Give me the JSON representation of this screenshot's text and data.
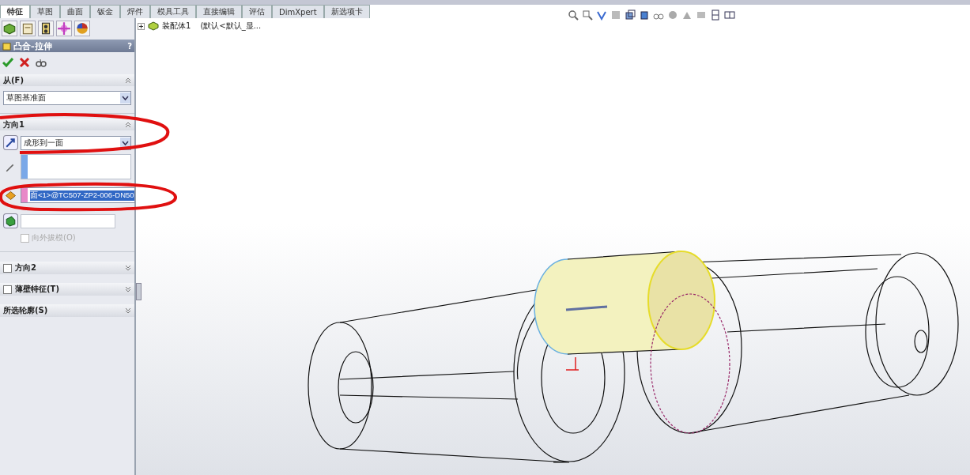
{
  "tabs": [
    {
      "label": "特征",
      "selected": true
    },
    {
      "label": "草图",
      "selected": false
    },
    {
      "label": "曲面",
      "selected": false
    },
    {
      "label": "钣金",
      "selected": false
    },
    {
      "label": "焊件",
      "selected": false
    },
    {
      "label": "模具工具",
      "selected": false
    },
    {
      "label": "直接编辑",
      "selected": false
    },
    {
      "label": "评估",
      "selected": false
    },
    {
      "label": "DimXpert",
      "selected": false
    },
    {
      "label": "新选项卡",
      "selected": false
    }
  ],
  "tree": {
    "label": "装配体1",
    "config": "(默认<默认_显..."
  },
  "property_manager": {
    "title": "凸合-拉伸",
    "help": "?",
    "sections": [
      {
        "kind": "from",
        "label": "从(F)",
        "field": "草图基准面"
      },
      {
        "kind": "direction",
        "label": "方向1",
        "end_condition": "成形到一面",
        "face": "面<1>@TC507-ZP2-006-DN50",
        "face_selected": true,
        "draft": {
          "label": "向外拔模(O)",
          "checked": false,
          "disabled": true
        }
      },
      {
        "kind": "collapsed",
        "label": "方向2",
        "checked": false
      },
      {
        "kind": "collapsed",
        "label": "薄壁特征(T)",
        "checked": false
      },
      {
        "kind": "collapsed",
        "label": "所选轮廓(S)"
      }
    ]
  }
}
